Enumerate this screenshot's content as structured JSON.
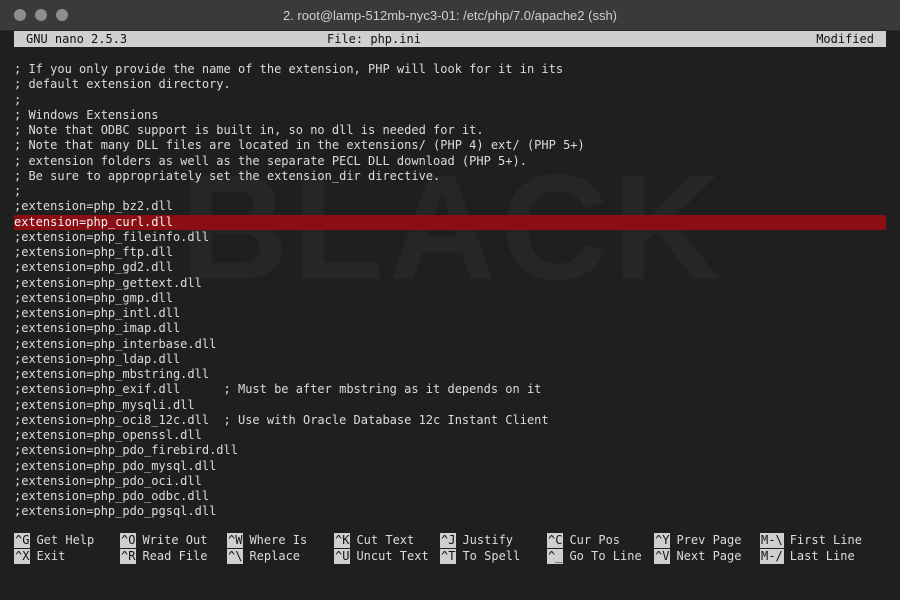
{
  "window": {
    "title": "2. root@lamp-512mb-nyc3-01: /etc/php/7.0/apache2 (ssh)",
    "traffic_lights": [
      "close",
      "minimize",
      "zoom"
    ]
  },
  "watermark": "BLACK",
  "nano": {
    "version": "GNU nano 2.5.3",
    "file": "File: php.ini",
    "status": "Modified"
  },
  "lines": [
    "; If you only provide the name of the extension, PHP will look for it in its",
    "; default extension directory.",
    ";",
    "; Windows Extensions",
    "; Note that ODBC support is built in, so no dll is needed for it.",
    "; Note that many DLL files are located in the extensions/ (PHP 4) ext/ (PHP 5+)",
    "; extension folders as well as the separate PECL DLL download (PHP 5+).",
    "; Be sure to appropriately set the extension_dir directive.",
    ";",
    ";extension=php_bz2.dll",
    "extension=php_curl.dll",
    ";extension=php_fileinfo.dll",
    ";extension=php_ftp.dll",
    ";extension=php_gd2.dll",
    ";extension=php_gettext.dll",
    ";extension=php_gmp.dll",
    ";extension=php_intl.dll",
    ";extension=php_imap.dll",
    ";extension=php_interbase.dll",
    ";extension=php_ldap.dll",
    ";extension=php_mbstring.dll",
    ";extension=php_exif.dll      ; Must be after mbstring as it depends on it",
    ";extension=php_mysqli.dll",
    ";extension=php_oci8_12c.dll  ; Use with Oracle Database 12c Instant Client",
    ";extension=php_openssl.dll",
    ";extension=php_pdo_firebird.dll",
    ";extension=php_pdo_mysql.dll",
    ";extension=php_pdo_oci.dll",
    ";extension=php_pdo_odbc.dll",
    ";extension=php_pdo_pgsql.dll"
  ],
  "highlight_line_index": 10,
  "shortcuts": {
    "row1": [
      {
        "key": "^G",
        "label": "Get Help"
      },
      {
        "key": "^O",
        "label": "Write Out"
      },
      {
        "key": "^W",
        "label": "Where Is"
      },
      {
        "key": "^K",
        "label": "Cut Text"
      },
      {
        "key": "^J",
        "label": "Justify"
      },
      {
        "key": "^C",
        "label": "Cur Pos"
      },
      {
        "key": "^Y",
        "label": "Prev Page"
      },
      {
        "key": "M-\\",
        "label": "First Line"
      }
    ],
    "row2": [
      {
        "key": "^X",
        "label": "Exit"
      },
      {
        "key": "^R",
        "label": "Read File"
      },
      {
        "key": "^\\",
        "label": "Replace"
      },
      {
        "key": "^U",
        "label": "Uncut Text"
      },
      {
        "key": "^T",
        "label": "To Spell"
      },
      {
        "key": "^_",
        "label": "Go To Line"
      },
      {
        "key": "^V",
        "label": "Next Page"
      },
      {
        "key": "M-/",
        "label": "Last Line"
      }
    ]
  },
  "colors": {
    "highlight": "#8b0e14",
    "header_bg": "#cfcfcf",
    "text": "#dcdcdc"
  }
}
